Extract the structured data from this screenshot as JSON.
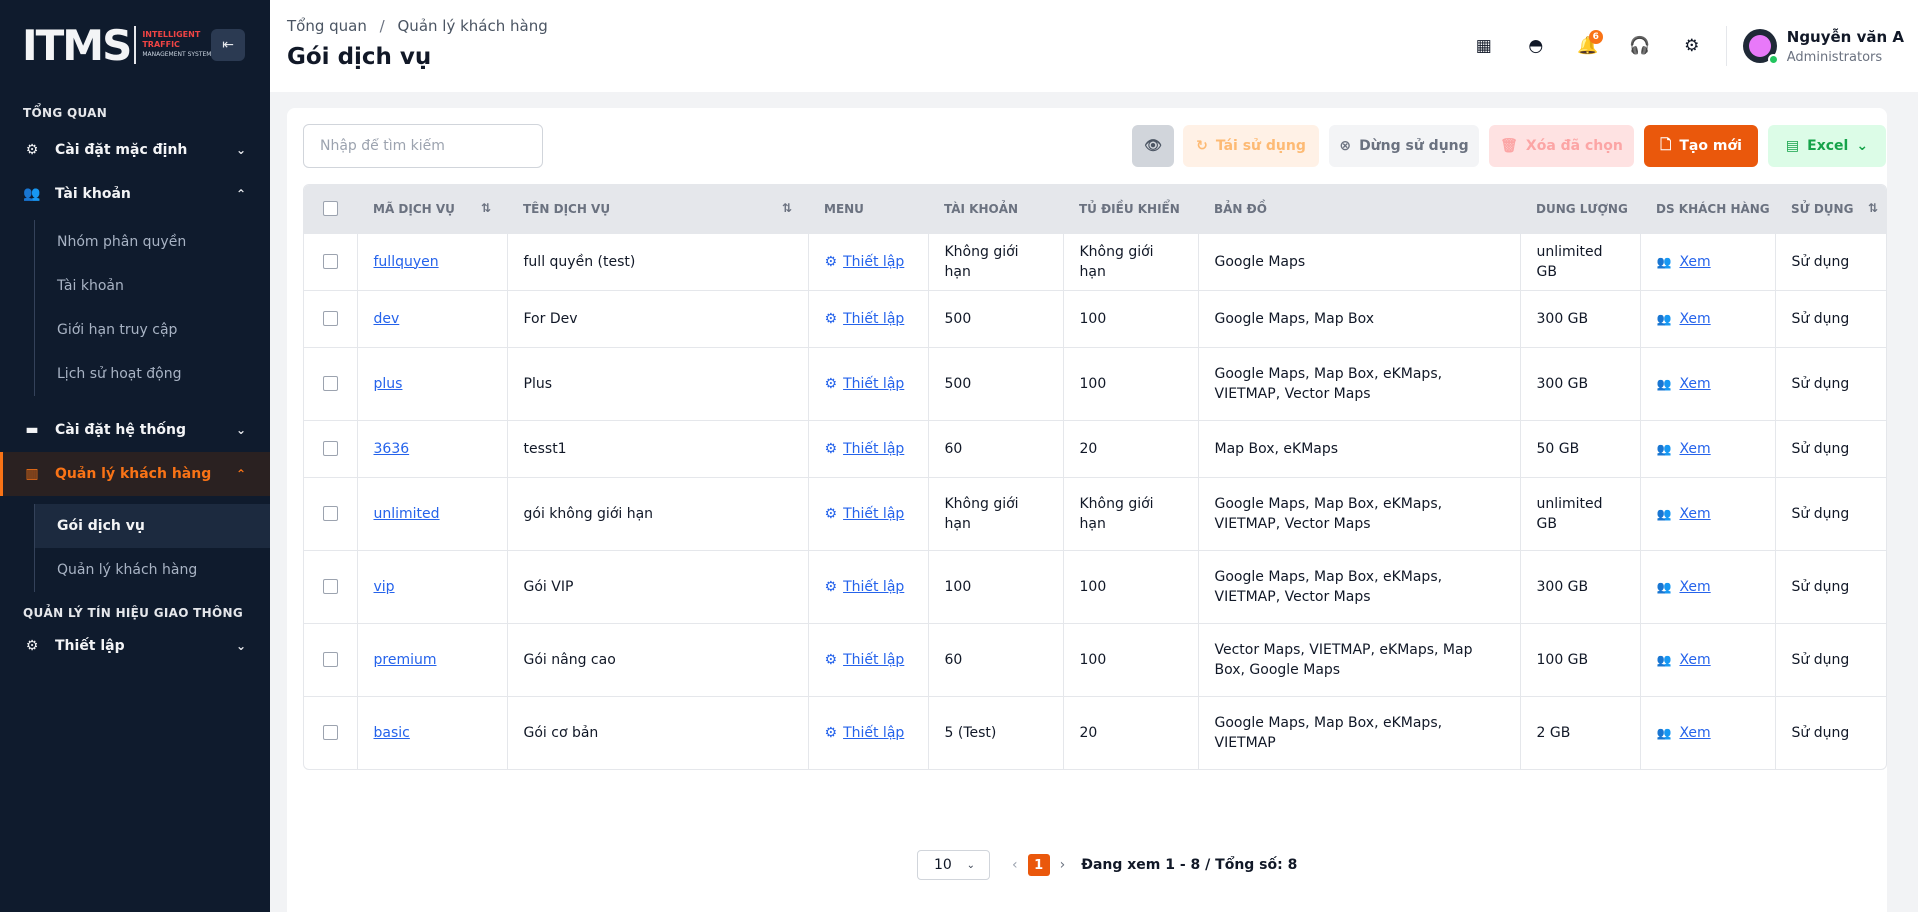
{
  "app": {
    "logo_mark": "ITMS",
    "logo_line1": "INTELLIGENT",
    "logo_line2": "TRAFFIC",
    "logo_line3": "MANAGEMENT SYSTEM"
  },
  "sidebar": {
    "section1": "TỔNG QUAN",
    "section2": "QUẢN LÝ TÍN HIỆU GIAO THÔNG",
    "items": [
      {
        "label": "Cài đặt mặc định",
        "icon": "gear-icon"
      },
      {
        "label": "Tài khoản",
        "icon": "users-icon"
      },
      {
        "label": "Cài đặt hệ thống",
        "icon": "card-icon"
      },
      {
        "label": "Quản lý khách hàng",
        "icon": "building-icon"
      },
      {
        "label": "Thiết lập",
        "icon": "gear-icon"
      }
    ],
    "account_sub": [
      "Nhóm phân quyền",
      "Tài khoản",
      "Giới hạn truy cập",
      "Lịch sử hoạt động"
    ],
    "customer_sub": [
      "Gói dịch vụ",
      "Quản lý khách hàng"
    ]
  },
  "header": {
    "breadcrumb": [
      "Tổng quan",
      "Quản lý khách hàng"
    ],
    "title": "Gói dịch vụ",
    "notif_count": "6",
    "user_name": "Nguyễn văn A",
    "user_role": "Administrators"
  },
  "toolbar": {
    "search_placeholder": "Nhập để tìm kiếm",
    "reuse": "Tái sử dụng",
    "stop": "Dừng sử dụng",
    "delete": "Xóa đã chọn",
    "create": "Tạo mới",
    "excel": "Excel"
  },
  "table": {
    "headers": [
      "MÃ DỊCH VỤ",
      "TÊN DỊCH VỤ",
      "MENU",
      "TÀI KHOẢN",
      "TỦ ĐIỀU KHIỂN",
      "BẢN ĐỒ",
      "DUNG LƯỢNG",
      "DS KHÁCH HÀNG",
      "SỬ DỤNG"
    ],
    "menu_link": "Thiết lập",
    "view_link": "Xem",
    "rows": [
      {
        "code": "fullquyen",
        "name": "full quyền (test)",
        "accounts": "Không giới hạn",
        "controllers": "Không giới hạn",
        "maps": "Google Maps",
        "storage": "unlimited GB",
        "status": "Sử dụng"
      },
      {
        "code": "dev",
        "name": "For Dev",
        "accounts": "500",
        "controllers": "100",
        "maps": "Google Maps, Map Box",
        "storage": "300 GB",
        "status": "Sử dụng"
      },
      {
        "code": "plus",
        "name": "Plus",
        "accounts": "500",
        "controllers": "100",
        "maps": "Google Maps, Map Box, eKMaps, VIETMAP, Vector Maps",
        "storage": "300 GB",
        "status": "Sử dụng"
      },
      {
        "code": "3636",
        "name": "tesst1",
        "accounts": "60",
        "controllers": "20",
        "maps": "Map Box, eKMaps",
        "storage": "50 GB",
        "status": "Sử dụng"
      },
      {
        "code": "unlimited",
        "name": "gói không giới hạn",
        "accounts": "Không giới hạn",
        "controllers": "Không giới hạn",
        "maps": "Google Maps, Map Box, eKMaps, VIETMAP, Vector Maps",
        "storage": "unlimited GB",
        "status": "Sử dụng"
      },
      {
        "code": "vip",
        "name": "Gói VIP",
        "accounts": "100",
        "controllers": "100",
        "maps": "Google Maps, Map Box, eKMaps, VIETMAP, Vector Maps",
        "storage": "300 GB",
        "status": "Sử dụng"
      },
      {
        "code": "premium",
        "name": "Gói nâng cao",
        "accounts": "60",
        "controllers": "100",
        "maps": "Vector Maps, VIETMAP, eKMaps, Map Box, Google Maps",
        "storage": "100 GB",
        "status": "Sử dụng"
      },
      {
        "code": "basic",
        "name": "Gói cơ bản",
        "accounts": "5 (Test)",
        "controllers": "20",
        "maps": "Google Maps, Map Box, eKMaps, VIETMAP",
        "storage": "2 GB",
        "status": "Sử dụng"
      }
    ]
  },
  "pagination": {
    "page_size": "10",
    "current_page": "1",
    "info": "Đang xem 1 - 8 / Tổng số: 8"
  },
  "colors": {
    "accent": "#ea580c",
    "sidebar_bg": "#0f1b2d",
    "link": "#2563eb"
  }
}
